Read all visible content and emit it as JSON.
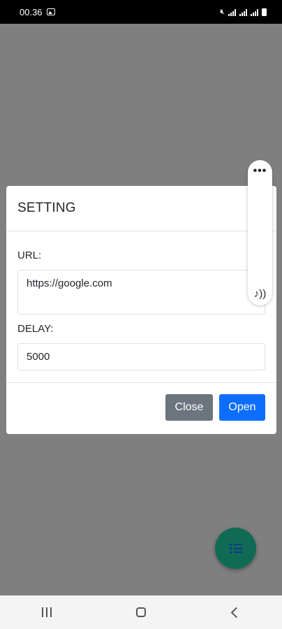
{
  "status_bar": {
    "time": "00.36",
    "icons": [
      "image-icon",
      "mute-icon",
      "signal-icon",
      "signal-4g-icon",
      "signal-icon",
      "battery-icon"
    ]
  },
  "dialog": {
    "title": "SETTING",
    "url_label": "URL:",
    "url_value": "https://google.com",
    "delay_label": "DELAY:",
    "delay_value": "5000",
    "close_label": "Close",
    "open_label": "Open"
  },
  "floating_panel": {
    "more_label": "•••",
    "music_label": "♪))"
  },
  "fab": {
    "icon": "list-icon"
  },
  "colors": {
    "overlay": "#7f7f7f",
    "close_button": "#6c757d",
    "open_button": "#0d6efd",
    "fab": "#116b54"
  },
  "nav_bar": {
    "buttons": [
      "recents-icon",
      "home-icon",
      "back-icon"
    ]
  }
}
